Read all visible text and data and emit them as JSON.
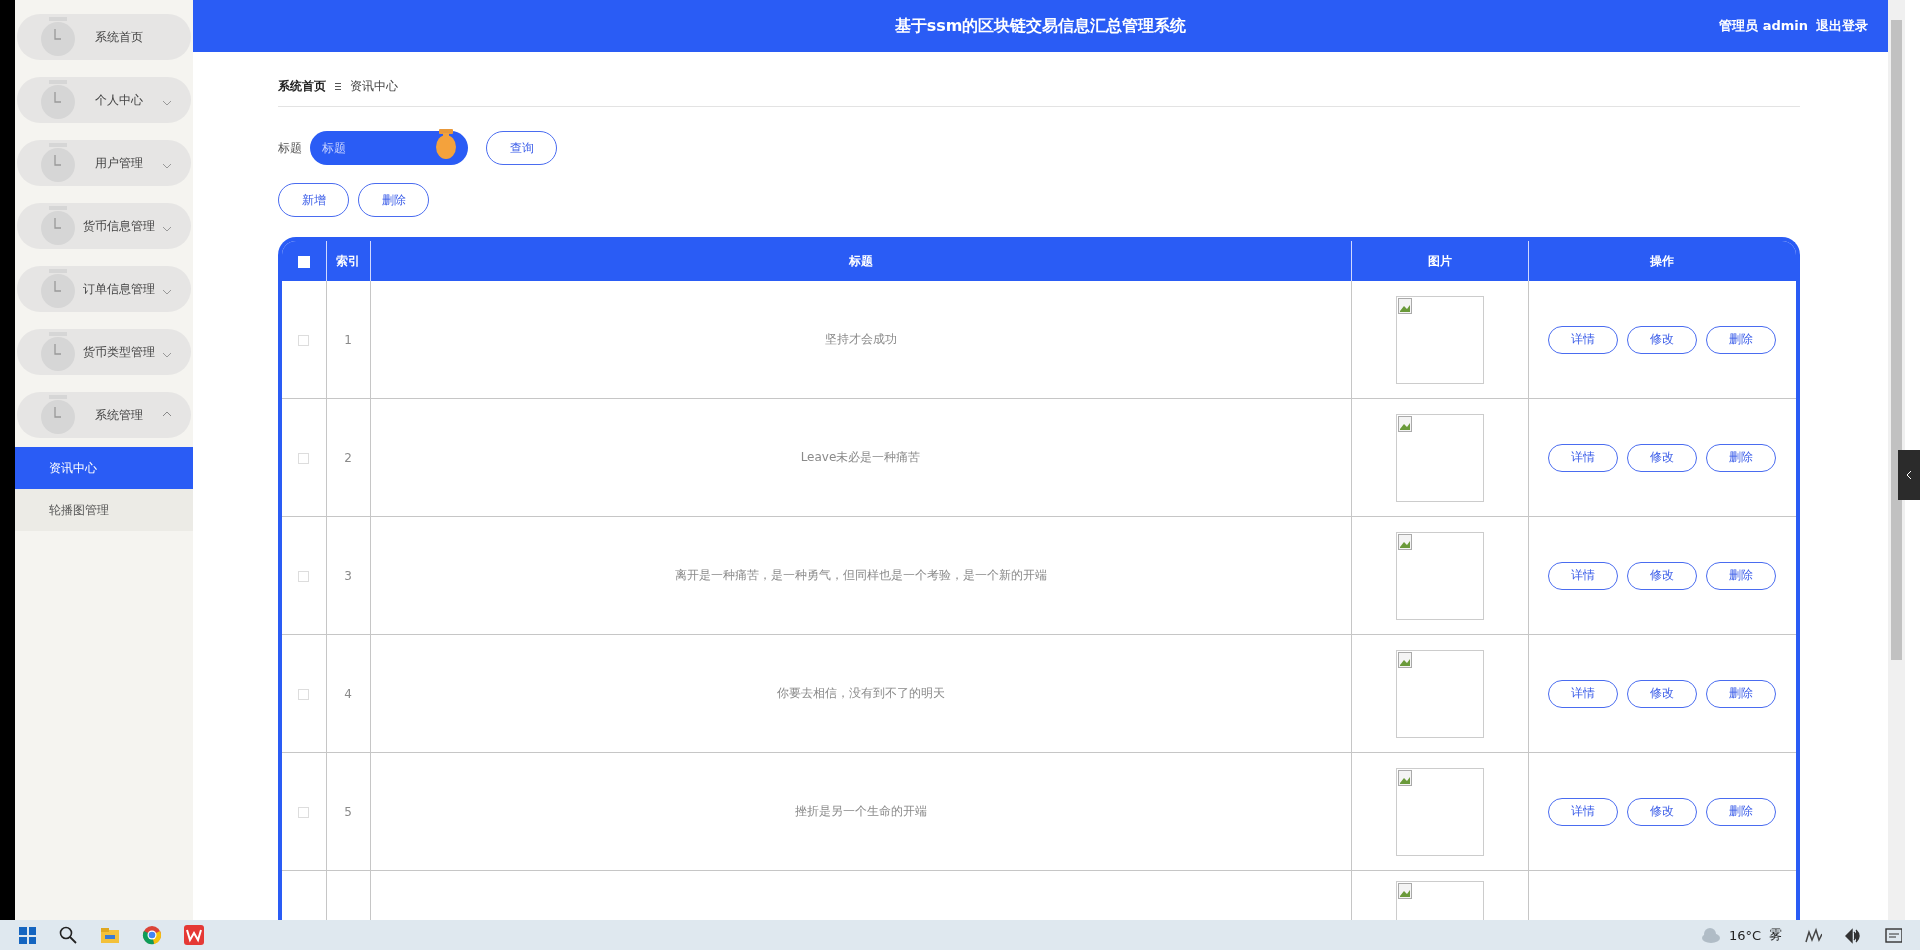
{
  "header": {
    "title": "基于ssm的区块链交易信息汇总管理系统",
    "user": "管理员 admin",
    "logout": "退出登录"
  },
  "sidebar": {
    "items": [
      {
        "label": "系统首页",
        "kind": "link"
      },
      {
        "label": "个人中心",
        "kind": "menu",
        "expanded": false
      },
      {
        "label": "用户管理",
        "kind": "menu",
        "expanded": false
      },
      {
        "label": "货币信息管理",
        "kind": "menu",
        "expanded": false
      },
      {
        "label": "订单信息管理",
        "kind": "menu",
        "expanded": false
      },
      {
        "label": "货币类型管理",
        "kind": "menu",
        "expanded": false
      },
      {
        "label": "系统管理",
        "kind": "menu",
        "expanded": true,
        "children": [
          {
            "label": "资讯中心",
            "selected": true
          },
          {
            "label": "轮播图管理",
            "selected": false
          }
        ]
      }
    ]
  },
  "breadcrumb": [
    "系统首页",
    "资讯中心"
  ],
  "search": {
    "label": "标题",
    "placeholder": "标题",
    "button": "查询"
  },
  "actions": [
    "新增",
    "删除"
  ],
  "table": {
    "all_checked": false,
    "columns": [
      "索引",
      "标题",
      "图片",
      "操作"
    ],
    "rows": [
      {
        "checked": false,
        "index": "1",
        "title": "坚持才会成功",
        "actions": [
          "详情",
          "修改",
          "删除"
        ]
      },
      {
        "checked": false,
        "index": "2",
        "title": "Leave未必是一种痛苦",
        "actions": [
          "详情",
          "修改",
          "删除"
        ]
      },
      {
        "checked": false,
        "index": "3",
        "title": "离开是一种痛苦，是一种勇气，但同样也是一个考验，是一个新的开端",
        "actions": [
          "详情",
          "修改",
          "删除"
        ]
      },
      {
        "checked": false,
        "index": "4",
        "title": "你要去相信，没有到不了的明天",
        "actions": [
          "详情",
          "修改",
          "删除"
        ]
      },
      {
        "checked": false,
        "index": "5",
        "title": "挫折是另一个生命的开端",
        "actions": [
          "详情",
          "修改",
          "删除"
        ]
      }
    ]
  },
  "taskbar": {
    "temperature": "16°C",
    "weather": "雾"
  }
}
